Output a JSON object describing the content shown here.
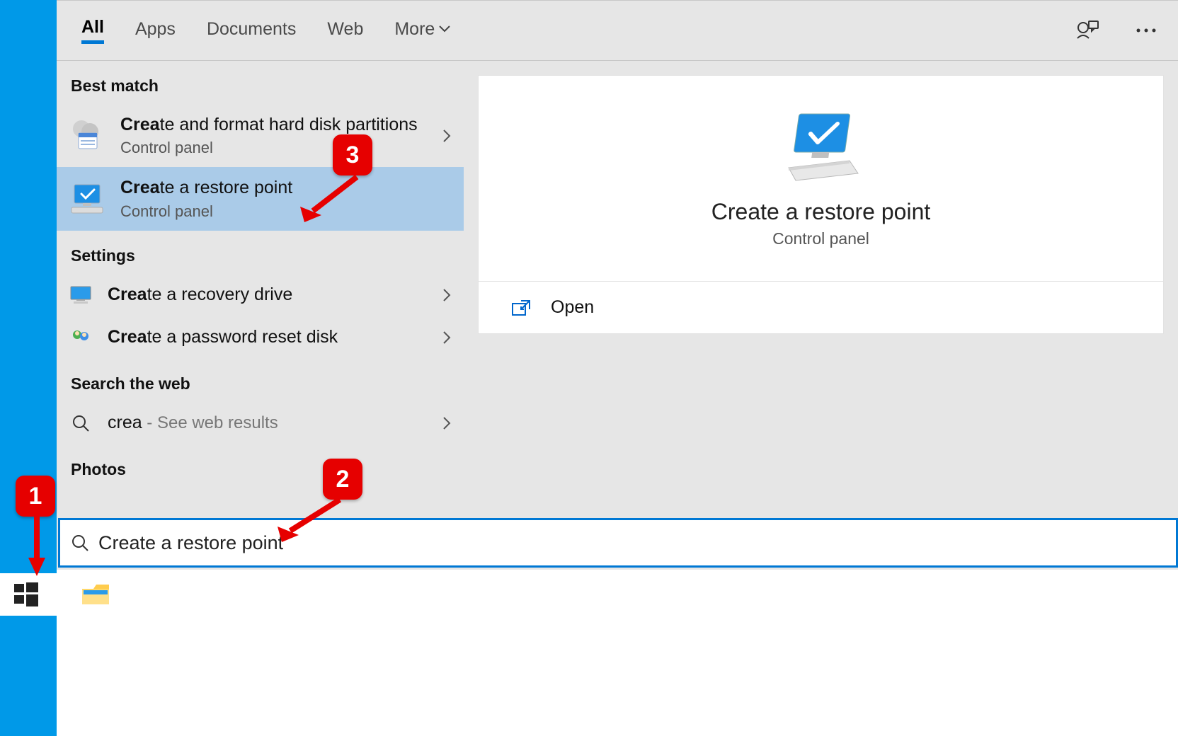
{
  "tabs": {
    "all": "All",
    "apps": "Apps",
    "documents": "Documents",
    "web": "Web",
    "more": "More"
  },
  "sections": {
    "best_match": "Best match",
    "settings": "Settings",
    "search_web": "Search the web",
    "photos": "Photos"
  },
  "results": {
    "disk": {
      "title_bold": "Crea",
      "title_rest": "te and format hard disk partitions",
      "subtitle": "Control panel"
    },
    "restore": {
      "title_bold": "Crea",
      "title_rest": "te a restore point",
      "subtitle": "Control panel"
    },
    "recovery": {
      "title_bold": "Crea",
      "title_rest": "te a recovery drive"
    },
    "password": {
      "title_bold": "Crea",
      "title_rest": "te a password reset disk"
    },
    "web": {
      "query": "crea",
      "suffix": " - See web results"
    }
  },
  "preview": {
    "title": "Create a restore point",
    "subtitle": "Control panel",
    "open": "Open"
  },
  "search": {
    "value": "Create a restore point"
  },
  "annotations": {
    "a1": "1",
    "a2": "2",
    "a3": "3"
  }
}
